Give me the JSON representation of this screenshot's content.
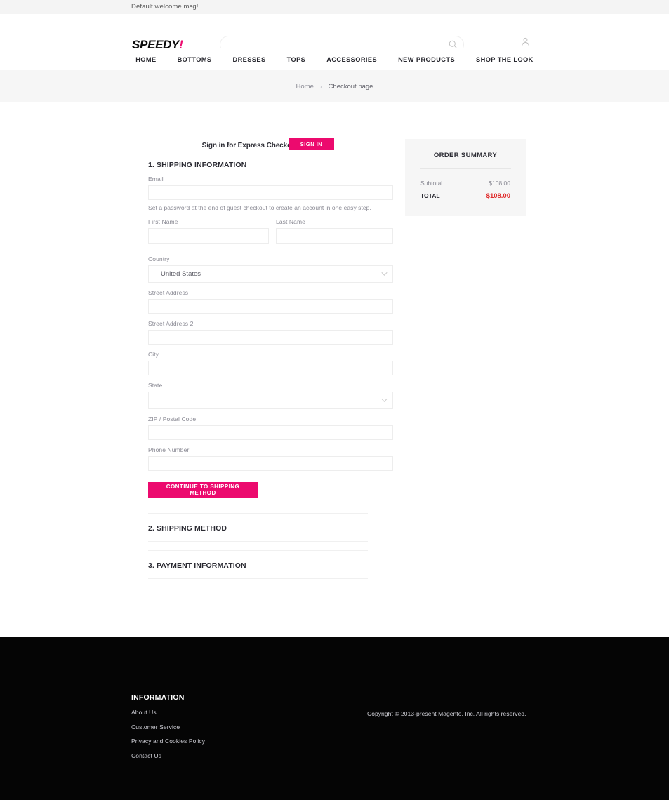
{
  "topbar": {
    "welcome": "Default welcome msg!"
  },
  "header": {
    "logo_text": "SPEEDY",
    "logo_bang": "!",
    "search_placeholder": "",
    "search_value": "",
    "account_label": "My Account"
  },
  "nav": {
    "items": [
      {
        "label": "HOME"
      },
      {
        "label": "BOTTOMS"
      },
      {
        "label": "DRESSES"
      },
      {
        "label": "TOPS"
      },
      {
        "label": "ACCESSORIES"
      },
      {
        "label": "NEW PRODUCTS"
      },
      {
        "label": "SHOP THE LOOK"
      }
    ]
  },
  "breadcrumb": {
    "home": "Home",
    "separator": "›",
    "current": "Checkout page"
  },
  "checkout": {
    "signin_prompt": "Sign in for Express Checkout",
    "signin_button": "SIGN IN",
    "section1_title": "1. SHIPPING INFORMATION",
    "email_label": "Email",
    "email_value": "",
    "password_hint": "Set a password at the end of guest checkout to create an account in one easy step.",
    "first_name_label": "First Name",
    "first_name_value": "",
    "last_name_label": "Last Name",
    "last_name_value": "",
    "country_label": "Country",
    "country_value": "United States",
    "street_label": "Street Address",
    "street_value": "",
    "street2_label": "Street Address 2",
    "street2_value": "",
    "city_label": "City",
    "city_value": "",
    "state_label": "State",
    "state_value": "",
    "zip_label": "ZIP / Postal Code",
    "zip_value": "",
    "phone_label": "Phone Number",
    "phone_value": "",
    "continue_button": "CONTINUE TO SHIPPING METHOD",
    "section2_title": "2. SHIPPING METHOD",
    "section3_title": "3. PAYMENT INFORMATION"
  },
  "summary": {
    "title": "ORDER SUMMARY",
    "rows": [
      {
        "label": "Subtotal",
        "value": "$108.00"
      }
    ],
    "total_label": "TOTAL",
    "total_value": "$108.00"
  },
  "footer": {
    "heading": "INFORMATION",
    "links": [
      {
        "label": "About Us"
      },
      {
        "label": "Customer Service"
      },
      {
        "label": "Privacy and Cookies Policy"
      },
      {
        "label": "Contact Us"
      }
    ],
    "copyright": "Copyright © 2013-present Magento, Inc. All rights reserved."
  },
  "colors": {
    "accent_pink": "#ec0a6e",
    "total_red": "#e02b2b",
    "footer_bg": "#050505",
    "band_gray": "#f6f6f6"
  }
}
